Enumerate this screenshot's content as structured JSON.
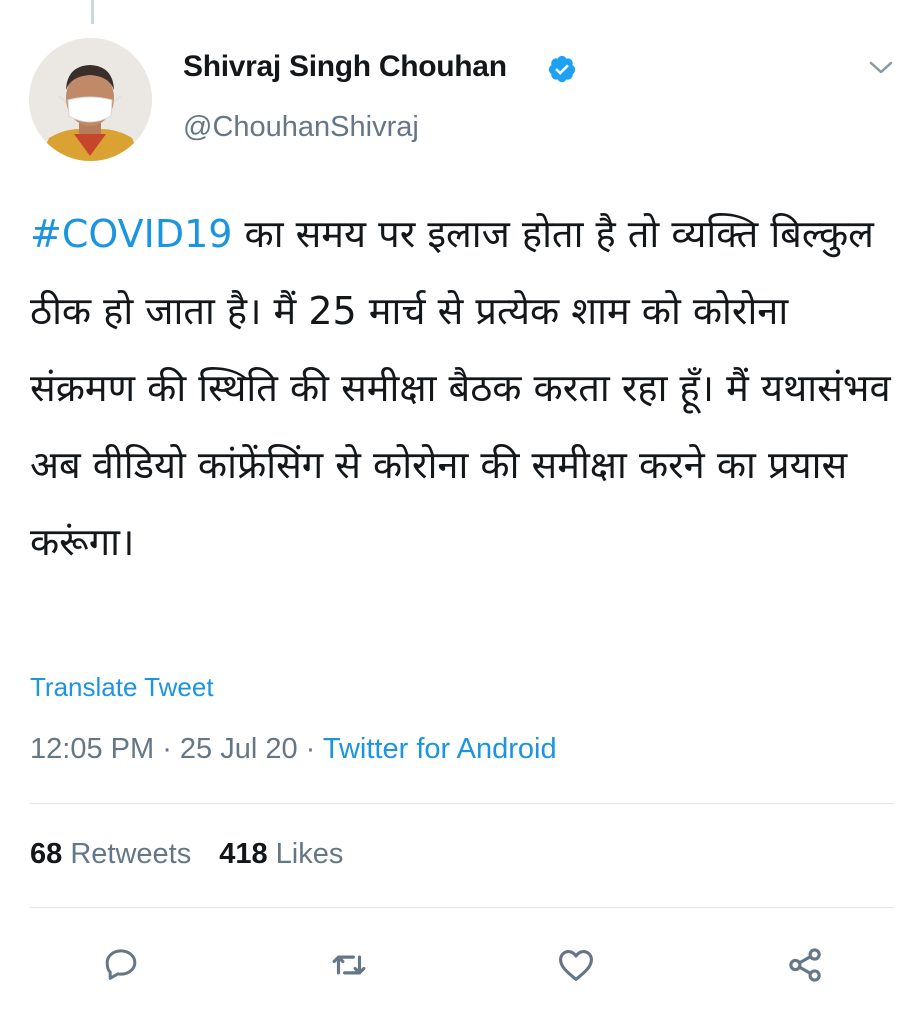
{
  "tweet": {
    "author_name": "Shivraj Singh Chouhan",
    "author_handle": "@ChouhanShivraj",
    "verified": true,
    "hashtag": "#COVID19",
    "text": " का समय पर इलाज होता है तो व्यक्ति बिल्कुल ठीक हो जाता है। मैं 25 मार्च से प्रत्येक शाम को कोरोना संक्रमण की स्थिति की समीक्षा बैठक करता रहा हूँ। मैं यथासंभव अब वीडियो कांफ्रेंसिंग से कोरोना की समीक्षा करने का प्रयास करूंगा।",
    "translate_label": "Translate Tweet",
    "time": "12:05 PM",
    "separator": " · ",
    "date": "25 Jul 20",
    "source": "Twitter for Android"
  },
  "stats": {
    "retweets_count": "68",
    "retweets_label": "Retweets",
    "likes_count": "418",
    "likes_label": "Likes"
  },
  "colors": {
    "link": "#1b95e0",
    "secondary_text": "#657786",
    "icon": "#657786"
  },
  "icons": {
    "reply": "reply-icon",
    "retweet": "retweet-icon",
    "like": "heart-icon",
    "share": "share-icon",
    "more": "chevron-down-icon",
    "verified": "verified-badge-icon"
  }
}
